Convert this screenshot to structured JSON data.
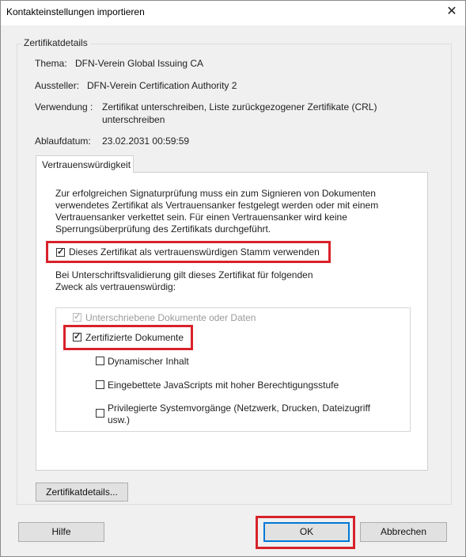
{
  "window": {
    "title": "Kontakteinstellungen importieren",
    "close_glyph": "✕"
  },
  "details": {
    "legend": "Zertifikatdetails",
    "subject_label": "Thema:",
    "subject_value": "DFN-Verein Global Issuing CA",
    "issuer_label": "Aussteller:",
    "issuer_value": "DFN-Verein Certification Authority 2",
    "usage_label": "Verwendung :",
    "usage_value_line1": "Zertifikat unterschreiben, Liste zurückgezogener Zertifikate (CRL)",
    "usage_value_line2": "unterschreiben",
    "expiry_label": "Ablaufdatum:",
    "expiry_value": "23.02.2031 00:59:59"
  },
  "trust_tab": {
    "tab_label": "Vertrauenswürdigkeit",
    "intro_lines": [
      "Zur erfolgreichen Signaturprüfung muss ein zum Signieren von Dokumenten",
      "verwendetes Zertifikat als Vertrauensanker festgelegt werden oder mit einem",
      "Vertrauensanker verkettet sein. Für einen Vertrauensanker wird keine",
      "Sperrungsüberprüfung des Zertifikats durchgeführt."
    ],
    "root_checkbox_label": "Dieses Zertifikat als vertrauenswürdigen Stamm verwenden",
    "purpose_lines": [
      "Bei Unterschriftsvalidierung gilt dieses Zertifikat für folgenden",
      "Zweck als vertrauenswürdig:"
    ],
    "options": {
      "signed_docs": "Unterschriebene Dokumente oder Daten",
      "certified_docs": "Zertifizierte Dokumente",
      "dynamic": "Dynamischer Inhalt",
      "javascripts": "Eingebettete JavaScripts mit hoher Berechtigungsstufe",
      "privileged_line1": "Privilegierte Systemvorgänge (Netzwerk, Drucken, Dateizugriff",
      "privileged_line2": "usw.)"
    }
  },
  "buttons": {
    "cert_details": "Zertifikatdetails...",
    "help": "Hilfe",
    "ok": "OK",
    "cancel": "Abbrechen"
  },
  "colors": {
    "highlight": "#d8222a",
    "accent": "#0078d7"
  }
}
